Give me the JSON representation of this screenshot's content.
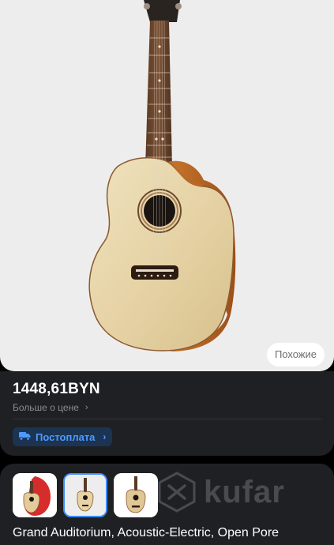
{
  "hero": {
    "similar_label": "Похожие"
  },
  "price_card": {
    "price": "1448,61BYN",
    "more_label": "Больше о цене",
    "postpay_label": "Постоплата"
  },
  "gallery": {
    "thumbnails": [
      "thumbnail-1",
      "thumbnail-2",
      "thumbnail-3"
    ],
    "active_index": 1,
    "watermark": "kufar"
  },
  "listing": {
    "title": "Grand Auditorium, Acoustic-Electric, Open Pore"
  },
  "colors": {
    "accent": "#3b8cff",
    "card_bg": "#1f2024",
    "hero_bg": "#eeedee"
  }
}
